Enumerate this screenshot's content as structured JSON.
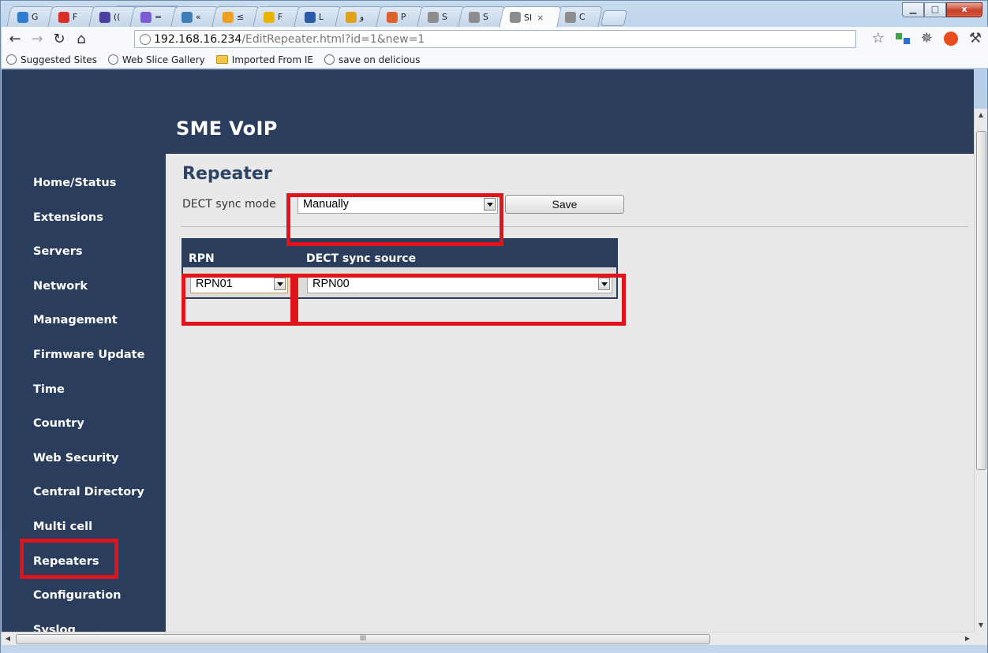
{
  "browser": {
    "tabs": [
      {
        "label": "G",
        "icon": "photos-icon",
        "color": "#2e7bcf"
      },
      {
        "label": "F",
        "icon": "gmail-icon",
        "color": "#d93025"
      },
      {
        "label": "((",
        "icon": "mail-icon",
        "color": "#4b3f9f"
      },
      {
        "label": "=",
        "icon": "circle-icon",
        "color": "#7b5cd6"
      },
      {
        "label": "«",
        "icon": "document-icon",
        "color": "#3c7fb8"
      },
      {
        "label": "≤",
        "icon": "star-icon",
        "color": "#f0a020"
      },
      {
        "label": "F",
        "icon": "gold-icon",
        "color": "#e8b400"
      },
      {
        "label": "L",
        "icon": "chart-icon",
        "color": "#2a5aa8"
      },
      {
        "label": "و",
        "icon": "analytics-icon",
        "color": "#e0a21b"
      },
      {
        "label": "P",
        "icon": "puzzle-icon",
        "color": "#e0602b"
      },
      {
        "label": "S",
        "icon": "globe-icon",
        "color": "#8d8d8d"
      },
      {
        "label": "S",
        "icon": "globe-icon",
        "color": "#8d8d8d"
      },
      {
        "label": "SI",
        "icon": "globe-icon",
        "color": "#8d8d8d",
        "active": true,
        "close": "×"
      },
      {
        "label": "C",
        "icon": "globe-icon",
        "color": "#8d8d8d"
      }
    ],
    "address": {
      "host": "192.168.16.234",
      "path": "/EditRepeater.html?id=1&new=1"
    },
    "bookmarks": [
      {
        "label": "Suggested Sites",
        "icon": "globe-icon"
      },
      {
        "label": "Web Slice Gallery",
        "icon": "globe-icon"
      },
      {
        "label": "Imported From IE",
        "icon": "folder-icon"
      },
      {
        "label": "save on delicious",
        "icon": "globe-icon"
      }
    ]
  },
  "app": {
    "brand": "SME VoIP",
    "nav": [
      "Home/Status",
      "Extensions",
      "Servers",
      "Network",
      "Management",
      "Firmware Update",
      "Time",
      "Country",
      "Web Security",
      "Central Directory",
      "Multi cell",
      "Repeaters",
      "Configuration",
      "Syslog"
    ],
    "page_title": "Repeater",
    "sync_mode": {
      "label": "DECT sync mode",
      "value": "Manually"
    },
    "save_label": "Save",
    "table": {
      "col_rpn": "RPN",
      "col_source": "DECT sync source",
      "rpn_value": "RPN01",
      "source_value": "RPN00"
    },
    "scroll_glyph": "III"
  },
  "colors": {
    "navy": "#2b3d5c",
    "highlight": "#e1131b",
    "title": "#2d4466"
  }
}
